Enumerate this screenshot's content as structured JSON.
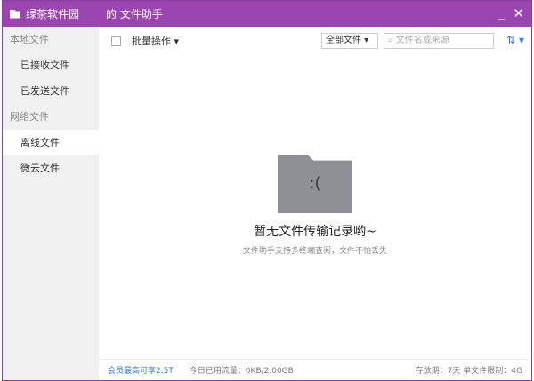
{
  "title": {
    "app": "绿茶软件园",
    "window": "的 文件助手",
    "minimize": "_",
    "close": "✕"
  },
  "sidebar": {
    "items": [
      {
        "label": "本地文件",
        "type": "group"
      },
      {
        "label": "已接收文件"
      },
      {
        "label": "已发送文件"
      },
      {
        "label": "网络文件",
        "type": "group"
      },
      {
        "label": "离线文件",
        "selected": true
      },
      {
        "label": "微云文件"
      }
    ]
  },
  "toolbar": {
    "batch": "批量操作 ▾",
    "filter": "全部文件 ▾",
    "search_placeholder": "文件名或来源",
    "sort": "⇅ ▾"
  },
  "empty": {
    "icon": ":(",
    "title": "暂无文件传输记录哟~",
    "subtitle": "文件助手支持多终端查阅，文件不怕丢失"
  },
  "footer": {
    "vip": "会员最高可享2.5T",
    "traffic": "今日已用流量：0KB/2.00GB",
    "limits": "存放期：7天   单文件限制：4G"
  }
}
